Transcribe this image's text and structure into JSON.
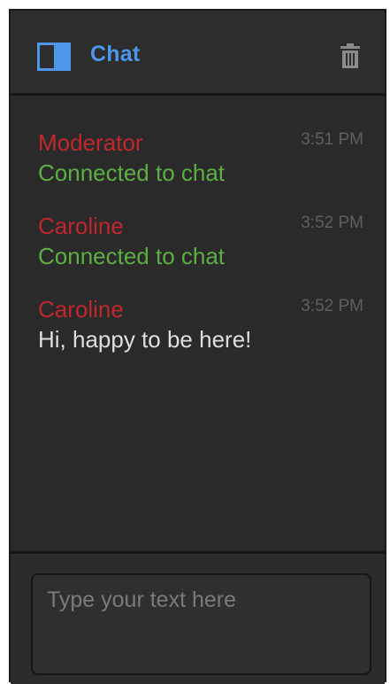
{
  "header": {
    "title": "Chat",
    "icons": {
      "panel": "panel-toggle-icon",
      "trash": "trash-icon"
    }
  },
  "messages": [
    {
      "author": "Moderator",
      "time": "3:51 PM",
      "text": "Connected to chat",
      "kind": "system"
    },
    {
      "author": "Caroline",
      "time": "3:52 PM",
      "text": "Connected to chat",
      "kind": "system"
    },
    {
      "author": "Caroline",
      "time": "3:52 PM",
      "text": "Hi, happy to be here!",
      "kind": "user"
    }
  ],
  "composer": {
    "placeholder": "Type your text here",
    "value": ""
  },
  "colors": {
    "accent": "#4e97e8",
    "author": "#c0272d",
    "system_text": "#5cae44",
    "user_text": "#dedede",
    "timestamp": "#5f5f5f",
    "background": "#2b2b2b"
  }
}
